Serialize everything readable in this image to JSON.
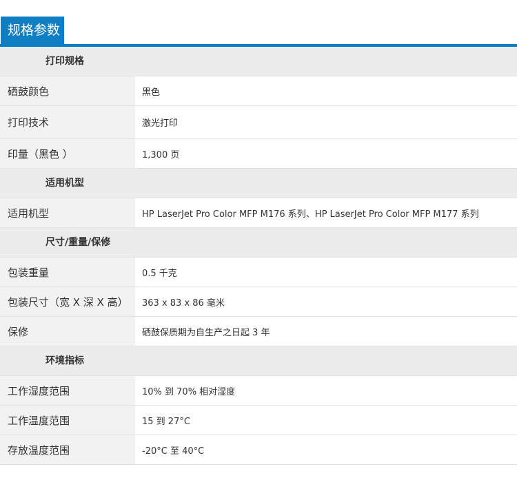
{
  "header": {
    "title": "规格参数"
  },
  "sections": [
    {
      "title": "打印规格",
      "rows": [
        {
          "label": "硒鼓颜色",
          "value": "黑色"
        },
        {
          "label": "打印技术",
          "value": "激光打印"
        },
        {
          "label": "印量（黑色 ）",
          "value": "1,300 页"
        }
      ]
    },
    {
      "title": "适用机型",
      "rows": [
        {
          "label": "适用机型",
          "value": "HP LaserJet Pro Color MFP M176 系列、HP LaserJet Pro Color MFP M177 系列"
        }
      ]
    },
    {
      "title": "尺寸/重量/保修",
      "rows": [
        {
          "label": "包装重量",
          "value": "0.5 千克"
        },
        {
          "label": "包装尺寸（宽 X 深 X 高）",
          "value": "363 x 83 x 86 毫米"
        },
        {
          "label": "保修",
          "value": "硒鼓保质期为自生产之日起 3 年"
        }
      ]
    },
    {
      "title": "环境指标",
      "rows": [
        {
          "label": "工作湿度范围",
          "value": "10% 到 70% 相对湿度"
        },
        {
          "label": "工作温度范围",
          "value": "15 到 27°C"
        },
        {
          "label": "存放温度范围",
          "value": "-20°C 至 40°C"
        }
      ]
    }
  ]
}
